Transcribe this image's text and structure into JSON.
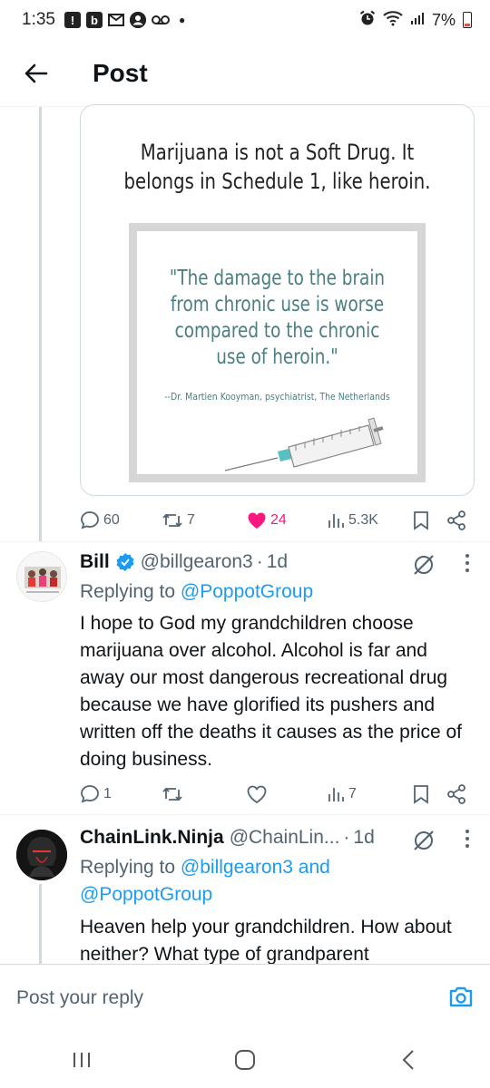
{
  "status_bar": {
    "time": "1:35",
    "battery": "7%",
    "left_icons": [
      "alert-icon",
      "b-app-icon",
      "gmail-icon",
      "account-icon",
      "voicemail-icon",
      "dot-icon"
    ],
    "right_icons": [
      "alarm-icon",
      "wifi-icon",
      "signal-icon",
      "battery-icon"
    ]
  },
  "header": {
    "title": "Post",
    "back_icon": "arrow-left-icon"
  },
  "media": {
    "headline": "Marijuana is not a Soft Drug. It belongs in Schedule 1, like heroin.",
    "quote": "\"The damage to the brain from chronic use is worse compared to the chronic use of heroin.\"",
    "attribution": "--Dr. Martien Kooyman, psychiatrist, The Netherlands"
  },
  "main_actions": {
    "replies": "60",
    "reposts": "7",
    "likes": "24",
    "views": "5.3K"
  },
  "replies": [
    {
      "name": "Bill",
      "verified": true,
      "handle": "@billgearon3",
      "separator": "·",
      "time": "1d",
      "replying_prefix": "Replying to",
      "replying_to": "@PoppotGroup",
      "body": "I hope to God my grandchildren choose marijuana over alcohol. Alcohol is far and away our most dangerous recreational drug because we have glorified its pushers and written off the deaths it causes as the price of doing business.",
      "actions": {
        "replies": "1",
        "reposts": "",
        "likes": "",
        "views": "7"
      }
    },
    {
      "name": "ChainLink.Ninja",
      "verified": false,
      "handle": "@ChainLin...",
      "separator": "·",
      "time": "1d",
      "replying_prefix": "Replying to",
      "replying_to": "@billgearon3 and @PoppotGroup",
      "body": "Heaven help your grandchildren. How about neither? What type of grandparent"
    }
  ],
  "reply_bar": {
    "placeholder": "Post your reply",
    "camera_icon": "camera-icon"
  },
  "nav_bar": [
    "recents-icon",
    "home-icon",
    "back-icon"
  ],
  "colors": {
    "accent": "#1d9bf0",
    "like": "#f91880",
    "quote_text": "#4b7e81",
    "secondary_text": "#536471"
  }
}
